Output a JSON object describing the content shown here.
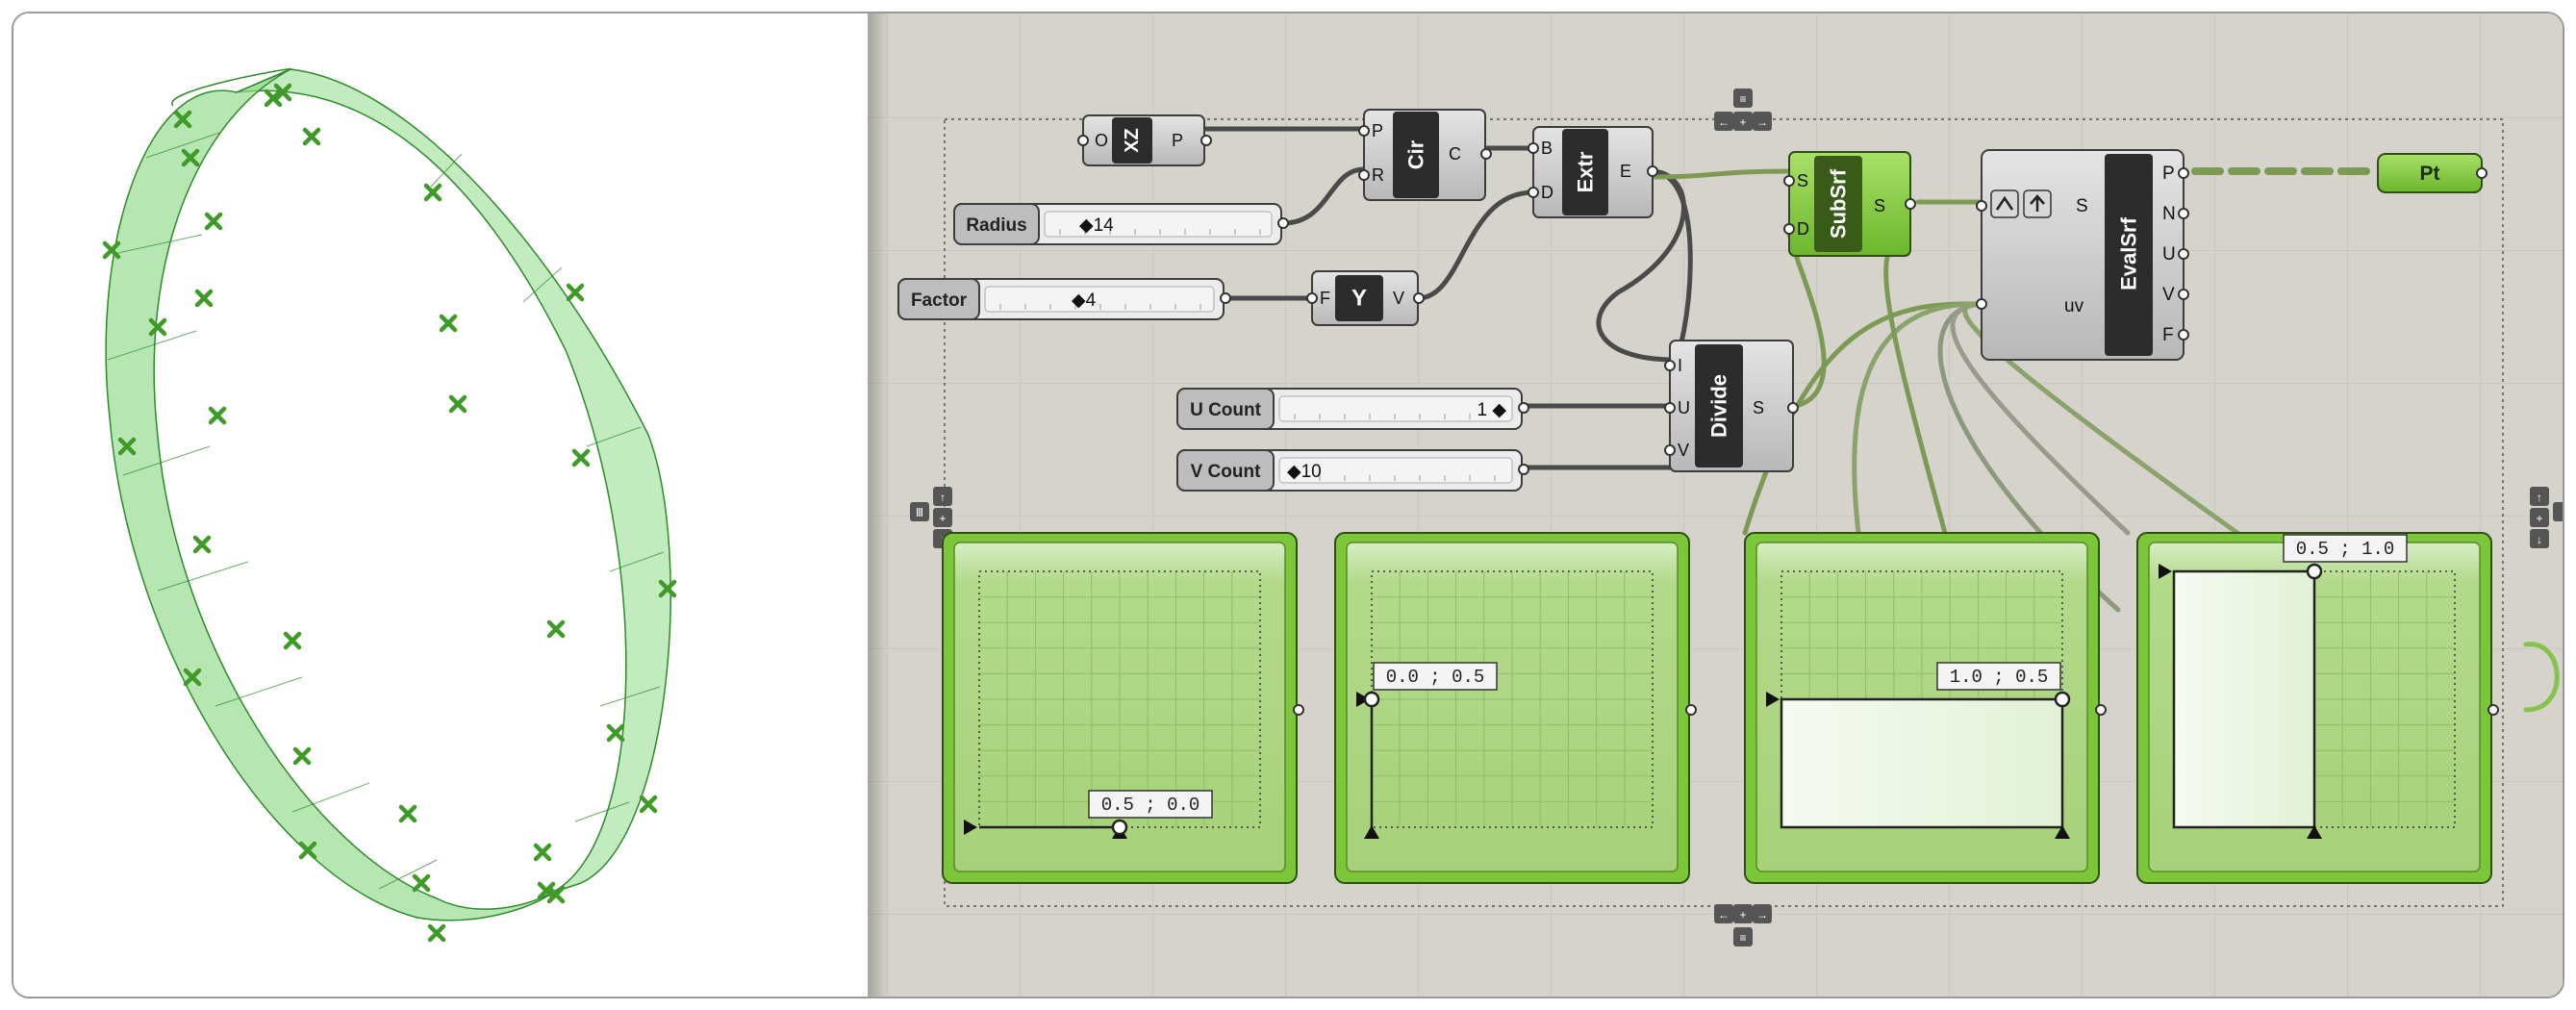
{
  "components": {
    "xz": {
      "nickname": "XZ",
      "inputs": [
        "O"
      ],
      "outputs": [
        "P"
      ]
    },
    "cir": {
      "nickname": "Cir",
      "inputs": [
        "P",
        "R"
      ],
      "outputs": [
        "C"
      ]
    },
    "extr": {
      "nickname": "Extr",
      "inputs": [
        "B",
        "D"
      ],
      "outputs": [
        "E"
      ]
    },
    "y": {
      "nickname": "Y",
      "inputs": [
        "F"
      ],
      "outputs": [
        "V"
      ]
    },
    "subsrf": {
      "nickname": "SubSrf",
      "inputs": [
        "S",
        "D"
      ],
      "outputs": [
        "S"
      ]
    },
    "evalsrf": {
      "nickname": "EvalSrf",
      "inputs": [
        "S",
        "uv"
      ],
      "outputs": [
        "P",
        "N",
        "U",
        "V",
        "F"
      ]
    },
    "divide": {
      "nickname": "Divide",
      "inputs": [
        "I",
        "U",
        "V"
      ],
      "outputs": [
        "S"
      ]
    },
    "pt": {
      "nickname": "Pt"
    }
  },
  "sliders": {
    "radius": {
      "label": "Radius",
      "value": "◆14"
    },
    "factor": {
      "label": "Factor",
      "value": "◆4"
    },
    "ucount": {
      "label": "U Count",
      "value": "1 ◆"
    },
    "vcount": {
      "label": "V Count",
      "value": "◆10"
    }
  },
  "mdsliders": [
    {
      "value_text": "0.5 ; 0.0",
      "u": 0.5,
      "v": 0.0
    },
    {
      "value_text": "0.0 ; 0.5",
      "u": 0.0,
      "v": 0.5
    },
    {
      "value_text": "1.0 ; 0.5",
      "u": 1.0,
      "v": 0.5
    },
    {
      "value_text": "0.5 ; 1.0",
      "u": 0.5,
      "v": 1.0
    }
  ],
  "colors": {
    "canvas": "#d6d3cc",
    "green_active": "#7cc63a",
    "wire_green": "#7d9a55",
    "ring_fill": "#8fda8a",
    "point_marker": "#3f9a28"
  },
  "icons": [
    "cross-marker-icon",
    "zoom-widget-icon",
    "arrow-up-icon",
    "rectangle-select-icon"
  ]
}
